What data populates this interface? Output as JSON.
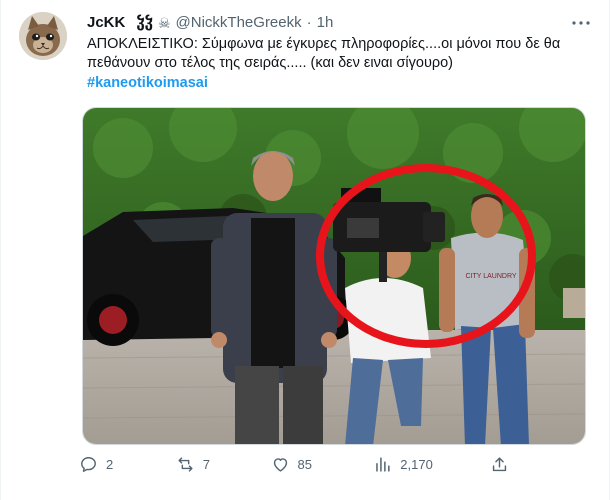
{
  "tweet": {
    "display_name": "JcKK",
    "name_extra": "ჴჴ",
    "skull_glyph": "☠",
    "handle": "@NickkTheGreekk",
    "dot": "·",
    "time": "1h",
    "more_glyph": "···",
    "text_line1": "ΑΠΟΚΛΕΙΣΤΙΚΟ: Σύμφωνα με έγκυρες πληροφορίες....οι μόνοι που δε θα",
    "text_line2": "πεθάνουν στο τέλος της σειράς..... (και δεν ειναι σίγουρο)",
    "hashtag": "#kaneotikoimasai"
  },
  "media": {
    "shirt_print": "CITY LAUNDRY",
    "annotation_color": "#e8141b"
  },
  "actions": {
    "replies": "2",
    "retweets": "7",
    "likes": "85",
    "views": "2,170"
  },
  "colors": {
    "text": "#0f1419",
    "secondary": "#536471",
    "link": "#1d9bf0",
    "border": "#cfd9de"
  },
  "icons": {
    "reply": "reply-icon",
    "retweet": "retweet-icon",
    "like": "heart-icon",
    "views": "views-icon",
    "share": "share-icon",
    "more": "more-icon"
  }
}
